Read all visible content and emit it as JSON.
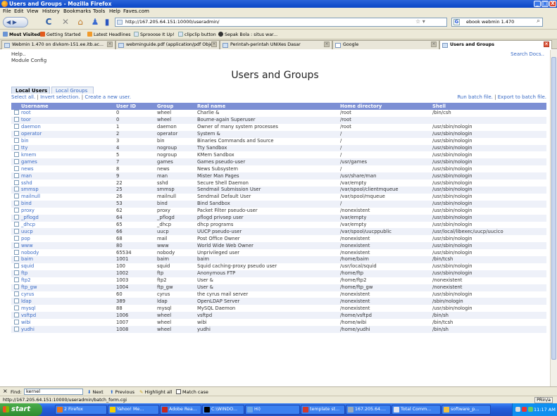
{
  "window": {
    "title": "Users and Groups - Mozilla Firefox",
    "min": "_",
    "max": "□",
    "close": "X"
  },
  "menu": [
    "File",
    "Edit",
    "View",
    "History",
    "Bookmarks",
    "Tools",
    "Help",
    "Faves.com"
  ],
  "nav": {
    "url": "http://167.205.64.151:10000/useradmin/",
    "search": "ebook webmin 1.470"
  },
  "bookmarks": [
    "Most Visited",
    "Getting Started",
    "Latest Headlines",
    "Sprooose It Up!",
    "clipclip button",
    "Sepak Bola : situs war..."
  ],
  "tabs": [
    "Webmin 1.470 on divkom-151.ee.itb.ac...",
    "webminguide.pdf (application/pdf Obje...",
    "Perintah-perintah UNIXes Dasar",
    "Google",
    "Users and Groups"
  ],
  "page": {
    "help": "Help..",
    "module_config": "Module Config",
    "title": "Users and Groups",
    "search_docs": "Search Docs..",
    "tab_local_users": "Local Users",
    "tab_local_groups": "Local Groups",
    "select_all": "Select all.",
    "invert_selection": "Invert selection.",
    "create_user": "Create a new user.",
    "sep": "|",
    "run_batch": "Run batch file.",
    "export_batch": "Export to batch file."
  },
  "table": {
    "headers": [
      "Username",
      "User ID",
      "Group",
      "Real name",
      "Home directory",
      "Shell"
    ],
    "rows": [
      [
        "root",
        "0",
        "wheel",
        "Charlie &",
        "/root",
        "/bin/csh"
      ],
      [
        "toor",
        "0",
        "wheel",
        "Bourne-again Superuser",
        "/root",
        ""
      ],
      [
        "daemon",
        "1",
        "daemon",
        "Owner of many system processes",
        "/root",
        "/usr/sbin/nologin"
      ],
      [
        "operator",
        "2",
        "operator",
        "System &",
        "/",
        "/usr/sbin/nologin"
      ],
      [
        "bin",
        "3",
        "bin",
        "Binaries Commands and Source",
        "/",
        "/usr/sbin/nologin"
      ],
      [
        "tty",
        "4",
        "nogroup",
        "Tty Sandbox",
        "/",
        "/usr/sbin/nologin"
      ],
      [
        "kmem",
        "5",
        "nogroup",
        "KMem Sandbox",
        "/",
        "/usr/sbin/nologin"
      ],
      [
        "games",
        "7",
        "games",
        "Games pseudo-user",
        "/usr/games",
        "/usr/sbin/nologin"
      ],
      [
        "news",
        "8",
        "news",
        "News Subsystem",
        "/",
        "/usr/sbin/nologin"
      ],
      [
        "man",
        "9",
        "man",
        "Mister Man Pages",
        "/usr/share/man",
        "/usr/sbin/nologin"
      ],
      [
        "sshd",
        "22",
        "sshd",
        "Secure Shell Daemon",
        "/var/empty",
        "/usr/sbin/nologin"
      ],
      [
        "smmsp",
        "25",
        "smmsp",
        "Sendmail Submission User",
        "/var/spool/clientmqueue",
        "/usr/sbin/nologin"
      ],
      [
        "mailnull",
        "26",
        "mailnull",
        "Sendmail Default User",
        "/var/spool/mqueue",
        "/usr/sbin/nologin"
      ],
      [
        "bind",
        "53",
        "bind",
        "Bind Sandbox",
        "/",
        "/usr/sbin/nologin"
      ],
      [
        "proxy",
        "62",
        "proxy",
        "Packet Filter pseudo-user",
        "/nonexistent",
        "/usr/sbin/nologin"
      ],
      [
        "_pflogd",
        "64",
        "_pflogd",
        "pflogd privsep user",
        "/var/empty",
        "/usr/sbin/nologin"
      ],
      [
        "_dhcp",
        "65",
        "_dhcp",
        "dhcp programs",
        "/var/empty",
        "/usr/sbin/nologin"
      ],
      [
        "uucp",
        "66",
        "uucp",
        "UUCP pseudo-user",
        "/var/spool/uucppublic",
        "/usr/local/libexec/uucp/uucico"
      ],
      [
        "pop",
        "68",
        "mail",
        "Post Office Owner",
        "/nonexistent",
        "/usr/sbin/nologin"
      ],
      [
        "www",
        "80",
        "www",
        "World Wide Web Owner",
        "/nonexistent",
        "/usr/sbin/nologin"
      ],
      [
        "nobody",
        "65534",
        "nobody",
        "Unprivileged user",
        "/nonexistent",
        "/usr/sbin/nologin"
      ],
      [
        "baim",
        "1001",
        "baim",
        "baim",
        "/home/baim",
        "/bin/tcsh"
      ],
      [
        "squid",
        "100",
        "squid",
        "Squid caching-proxy pseudo user",
        "/usr/local/squid",
        "/usr/sbin/nologin"
      ],
      [
        "ftp",
        "1002",
        "ftp",
        "Anonymous FTP",
        "/home/ftp",
        "/usr/sbin/nologin"
      ],
      [
        "ftp2",
        "1003",
        "ftp2",
        "User &",
        "/home/ftp2",
        "/nonexistent"
      ],
      [
        "ftp_gw",
        "1004",
        "ftp_gw",
        "User &",
        "/home/ftp_gw",
        "/nonexistent"
      ],
      [
        "cyrus",
        "60",
        "cyrus",
        "the cyrus mail server",
        "/nonexistent",
        "/usr/sbin/nologin"
      ],
      [
        "ldap",
        "389",
        "ldap",
        "OpenLDAP Server",
        "/nonexistent",
        "/sbin/nologin"
      ],
      [
        "mysql",
        "88",
        "mysql",
        "MySQL Daemon",
        "/nonexistent",
        "/usr/sbin/nologin"
      ],
      [
        "vsftpd",
        "1006",
        "wheel",
        "vsftpd",
        "/home/vsftpd",
        "/bin/sh"
      ],
      [
        "wibi",
        "1007",
        "wheel",
        "wibi",
        "/home/wibi",
        "/bin/tcsh"
      ],
      [
        "yudhi",
        "1008",
        "wheel",
        "yudhi",
        "/home/yudhi",
        "/bin/sh"
      ]
    ]
  },
  "findbar": {
    "close": "×",
    "label": "Find:",
    "value": "kernel",
    "next": "Next",
    "previous": "Previous",
    "highlight": "Highlight all",
    "match_case": "Match case"
  },
  "status": {
    "text": "http://167.205.64.151:10000/useradmin/batch_form.cgi",
    "indicator": "PRin/a"
  },
  "taskbar": {
    "start": "start",
    "tasks": [
      "2 Firefox",
      "Yahoo! Me...",
      "Adobe Rea...",
      "C:\\WINDO...",
      "Hi)",
      "template st...",
      "167.205.64....",
      "Total Comm...",
      "software_p..."
    ],
    "clock": "11:17 AM"
  },
  "icons": {
    "back": "back-arrow-icon",
    "forward": "forward-arrow-icon",
    "reload": "reload-icon",
    "stop": "stop-icon",
    "home": "home-icon"
  }
}
